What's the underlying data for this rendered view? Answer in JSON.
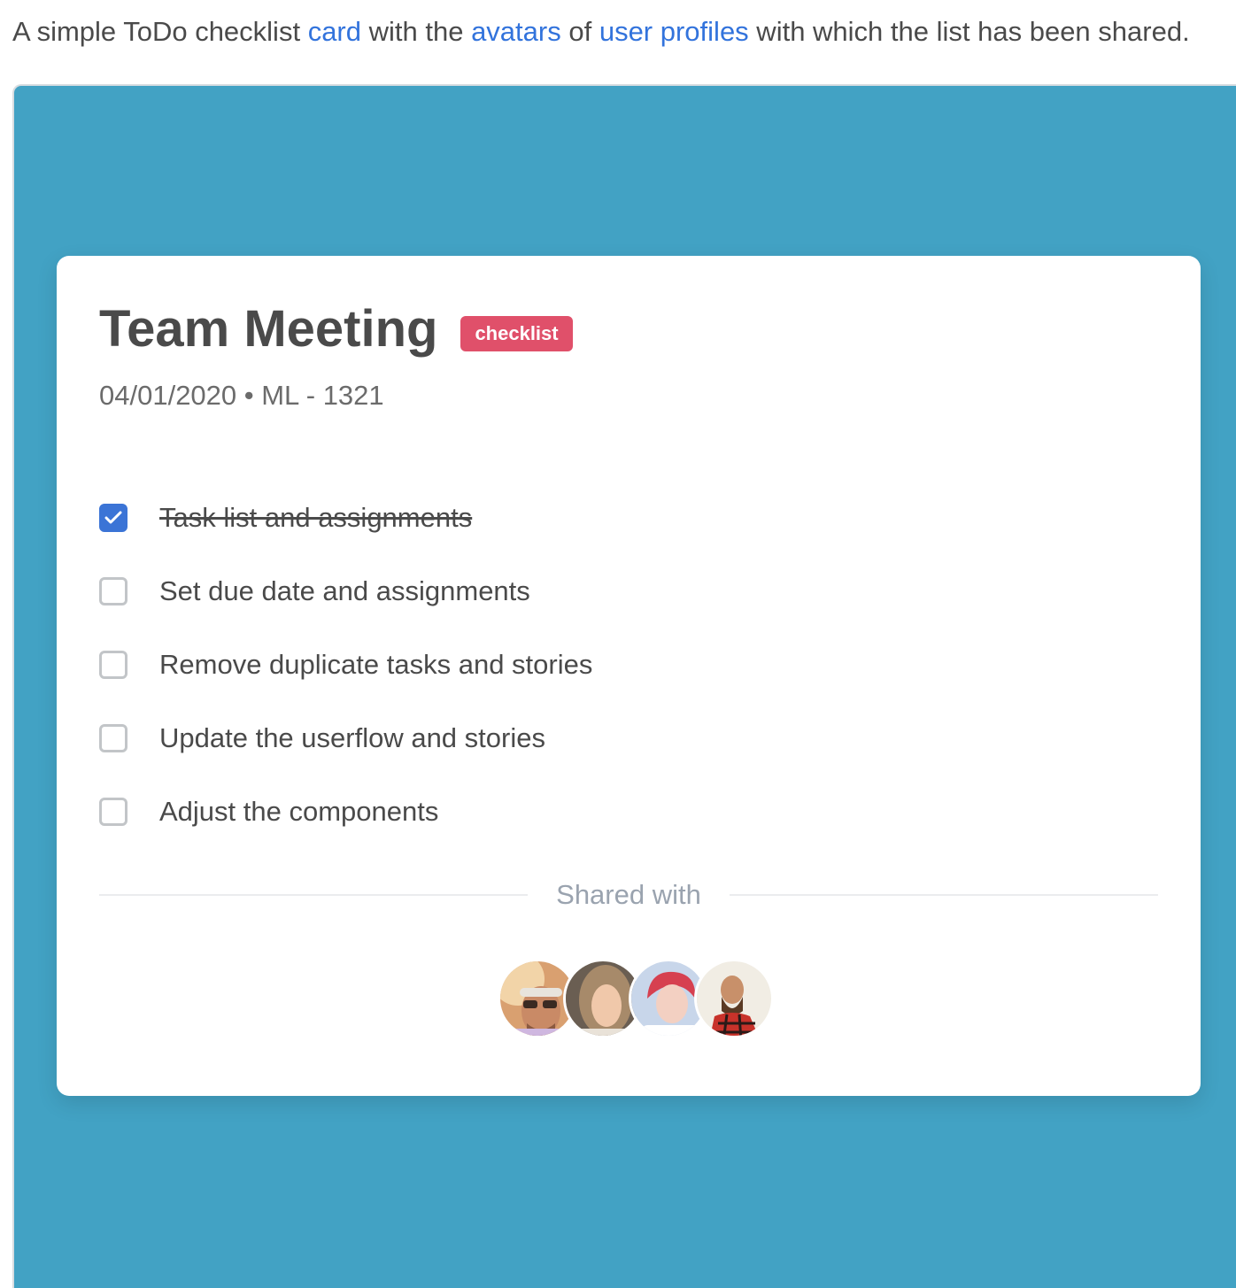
{
  "intro": {
    "part1": "A simple ToDo checklist ",
    "link_card": "card",
    "part2": " with the ",
    "link_avatars": "avatars",
    "part3": " of ",
    "link_profiles": "user profiles",
    "part4": " with which the list has been shared."
  },
  "card": {
    "title": "Team Meeting",
    "tag": "checklist",
    "meta": "04/01/2020 • ML - 1321",
    "tasks": [
      {
        "label": "Task list and assignments",
        "checked": true
      },
      {
        "label": "Set due date and assignments",
        "checked": false
      },
      {
        "label": "Remove duplicate tasks and stories",
        "checked": false
      },
      {
        "label": "Update the userflow and stories",
        "checked": false
      },
      {
        "label": "Adjust the components",
        "checked": false
      }
    ],
    "shared_label": "Shared with"
  },
  "colors": {
    "background": "#42a2c4",
    "tag": "#e0506a",
    "checkbox_checked": "#3b74d6",
    "link": "#3273dc"
  }
}
